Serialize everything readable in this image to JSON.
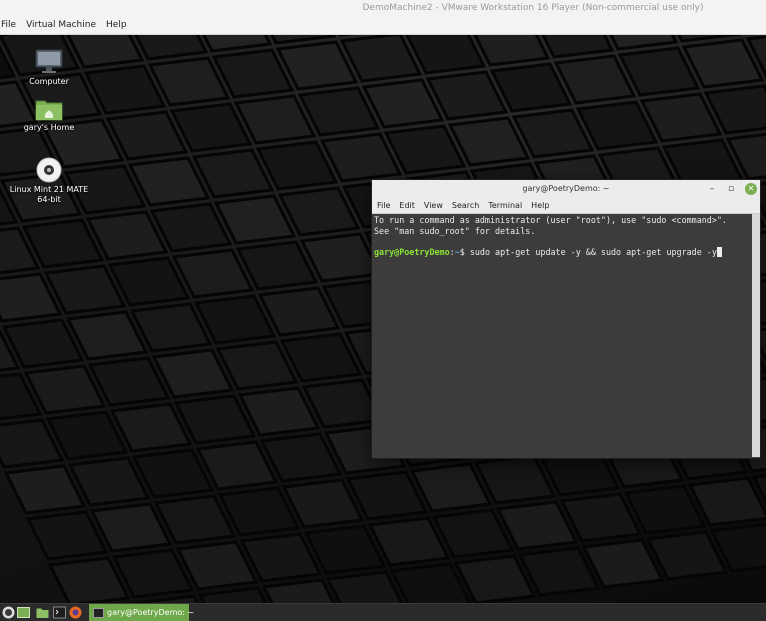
{
  "host": {
    "window_title": "DemoMachine2 - VMware Workstation 16 Player (Non-commercial use only)",
    "menu": [
      "File",
      "Virtual Machine",
      "Help"
    ]
  },
  "desktop": {
    "icons": [
      {
        "label": "Computer",
        "icon": "computer-icon"
      },
      {
        "label": "gary's Home",
        "icon": "home-folder-icon"
      },
      {
        "label": "Linux Mint 21 MATE\n64-bit",
        "label_line1": "Linux Mint 21 MATE",
        "label_line2": "64-bit",
        "icon": "disc-icon"
      }
    ]
  },
  "terminal": {
    "title": "gary@PoetryDemo: ~",
    "menu": [
      "File",
      "Edit",
      "View",
      "Search",
      "Terminal",
      "Help"
    ],
    "lines": [
      "To run a command as administrator (user \"root\"), use \"sudo <command>\".",
      "See \"man sudo_root\" for details."
    ],
    "prompt_user": "gary@PoetryDemo",
    "prompt_sep": ":",
    "prompt_path": "~",
    "prompt_symbol": "$ ",
    "command": "sudo apt-get update -y && sudo apt-get upgrade -y",
    "colors": {
      "prompt_user": "#8ae234",
      "prompt_path": "#729fcf",
      "background": "#3c3c3c"
    }
  },
  "taskbar": {
    "task_label": "gary@PoetryDemo: ~",
    "accent": "#6ea84a",
    "launchers": [
      "mint-menu-icon",
      "show-desktop-icon",
      "file-manager-icon",
      "terminal-launcher-icon",
      "firefox-icon"
    ]
  }
}
